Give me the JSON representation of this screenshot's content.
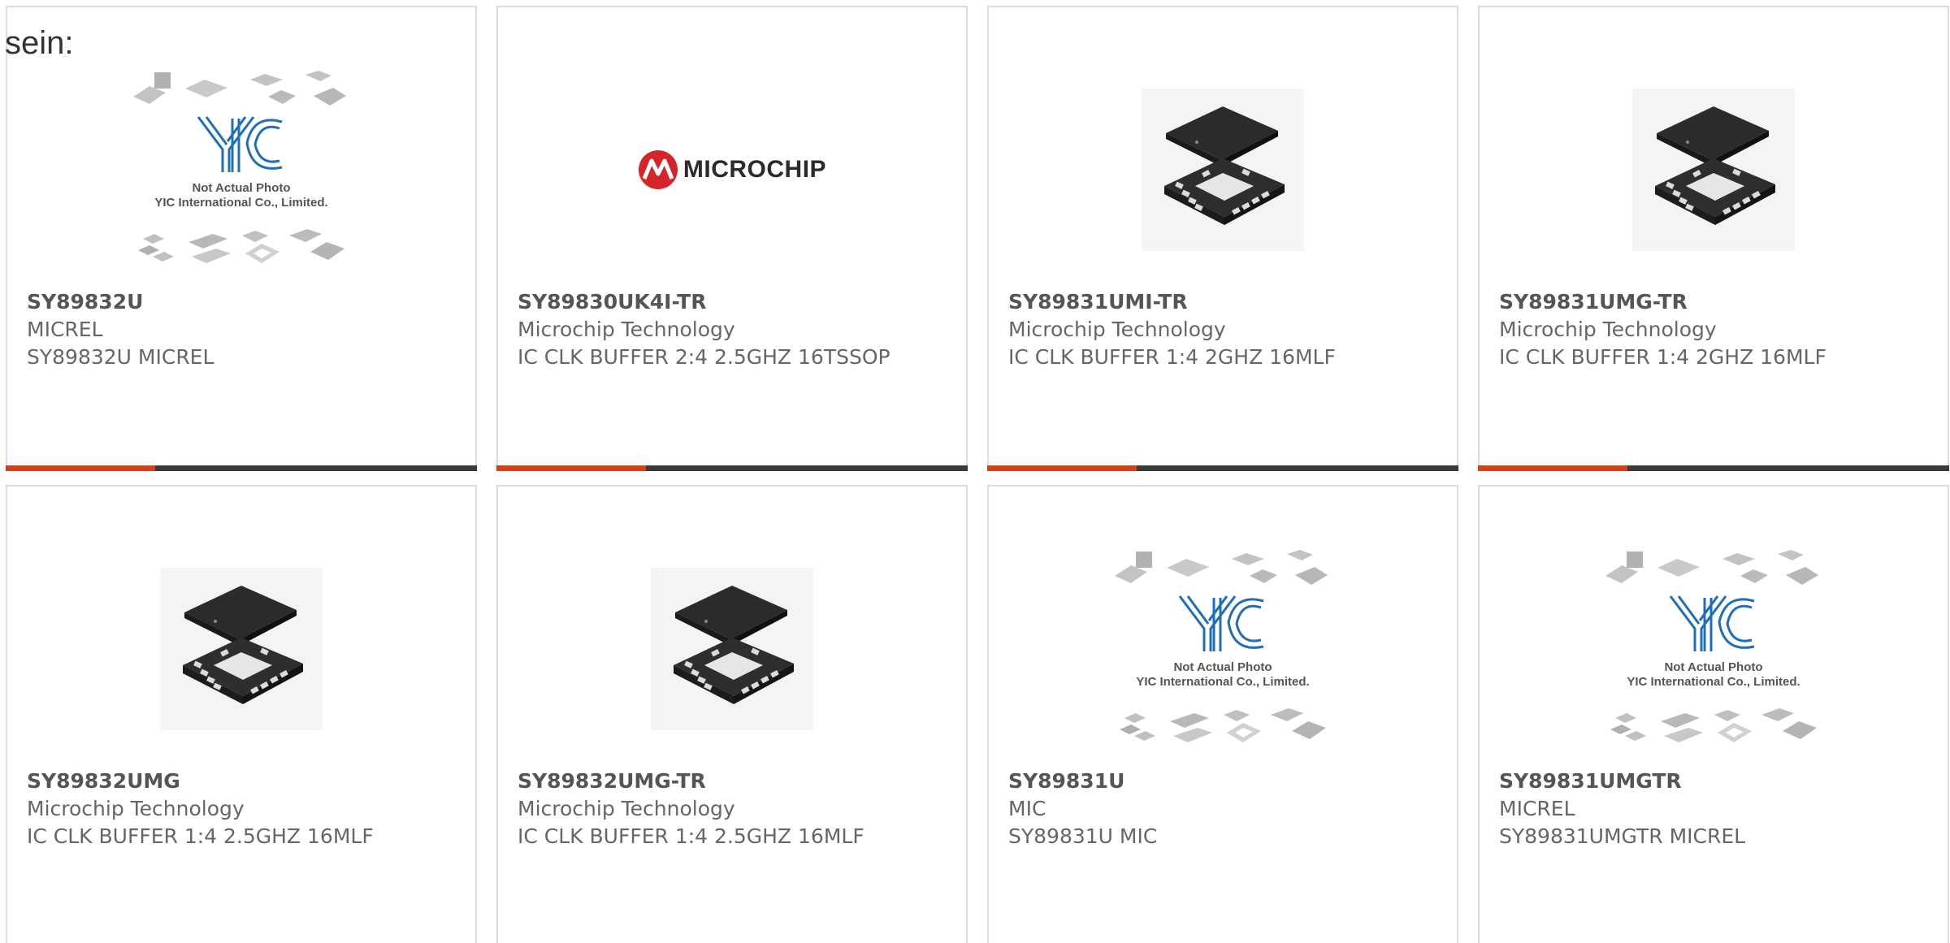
{
  "intro": "sein:",
  "cards": [
    {
      "part": "SY89832U",
      "maker": "MICREL",
      "desc": "SY89832U MICREL",
      "image": "yic-placeholder",
      "placeholder_line1": "Not Actual Photo",
      "placeholder_line2": "YIC International Co., Limited.",
      "logo_text": "YIC"
    },
    {
      "part": "SY89830UK4I-TR",
      "maker": "Microchip Technology",
      "desc": "IC CLK BUFFER 2:4 2.5GHZ 16TSSOP",
      "image": "microchip-logo",
      "logo_text": "MICROCHIP"
    },
    {
      "part": "SY89831UMI-TR",
      "maker": "Microchip Technology",
      "desc": "IC CLK BUFFER 1:4 2GHZ 16MLF",
      "image": "qfn-chip"
    },
    {
      "part": "SY89831UMG-TR",
      "maker": "Microchip Technology",
      "desc": "IC CLK BUFFER 1:4 2GHZ 16MLF",
      "image": "qfn-chip"
    },
    {
      "part": "SY89832UMG",
      "maker": "Microchip Technology",
      "desc": "IC CLK BUFFER 1:4 2.5GHZ 16MLF",
      "image": "qfn-chip"
    },
    {
      "part": "SY89832UMG-TR",
      "maker": "Microchip Technology",
      "desc": "IC CLK BUFFER 1:4 2.5GHZ 16MLF",
      "image": "qfn-chip"
    },
    {
      "part": "SY89831U",
      "maker": "MIC",
      "desc": "SY89831U MIC",
      "image": "yic-placeholder",
      "placeholder_line1": "Not Actual Photo",
      "placeholder_line2": "YIC International Co., Limited.",
      "logo_text": "YIC"
    },
    {
      "part": "SY89831UMGTR",
      "maker": "MICREL",
      "desc": "SY89831UMGTR MICREL",
      "image": "yic-placeholder",
      "placeholder_line1": "Not Actual Photo",
      "placeholder_line2": "YIC International Co., Limited.",
      "logo_text": "YIC"
    }
  ],
  "colors": {
    "accent": "#e03c12",
    "bar": "#3a3a3a",
    "yic_blue": "#1f6fb5",
    "microchip_red": "#d6242b"
  }
}
